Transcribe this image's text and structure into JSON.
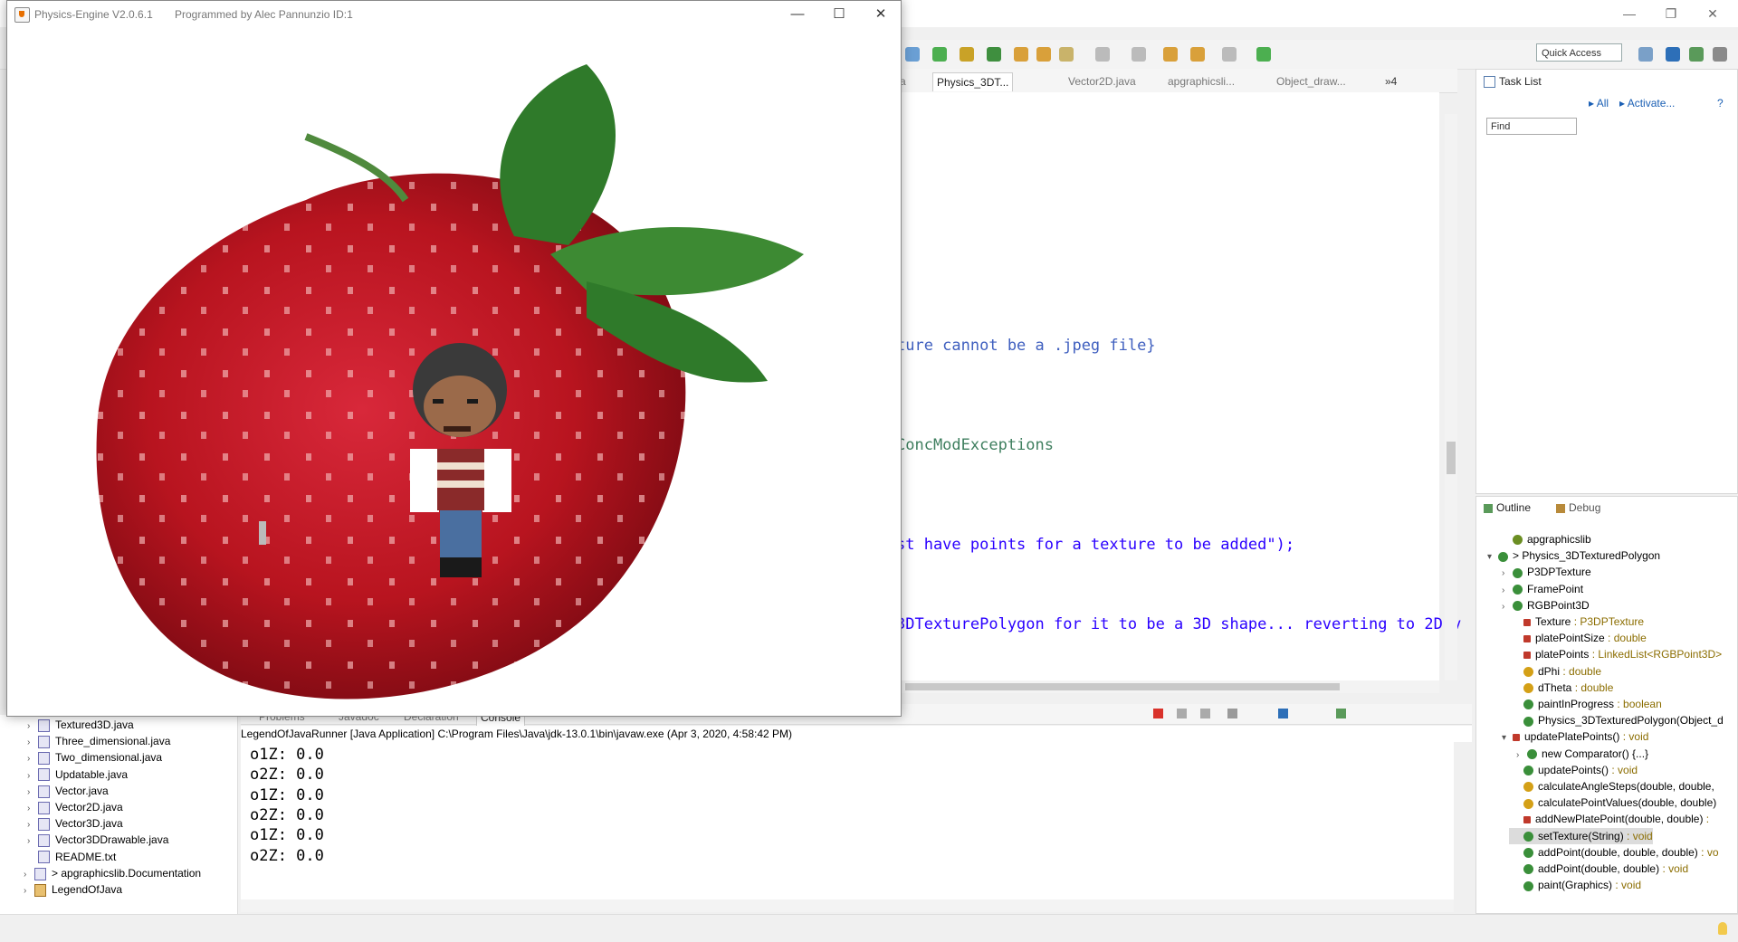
{
  "app_window": {
    "title": "Physics-Engine V2.0.6.1",
    "subtitle": "Programmed by Alec Pannunzio ID:1",
    "controls": {
      "minimize": "—",
      "maximize": "☐",
      "close": "✕"
    }
  },
  "ide": {
    "window_controls": {
      "minimize": "—",
      "restore": "❐",
      "close": "✕"
    },
    "quick_access_label": "Quick Access",
    "editor_tabs": [
      "a",
      "Physics_3DT...",
      "Vector2D.java",
      "apgraphicsli...",
      "Object_draw...",
      "»4"
    ],
    "code_fragments": [
      "ture cannot be a .jpeg file}",
      "ConcModExceptions",
      "st have points for a texture to be added\");",
      "3DTexturePolygon for it to be a 3D shape... reverting to 2D v"
    ],
    "task_list": {
      "tab": "Task List",
      "find_placeholder": "Find",
      "all_label": "All",
      "activate_label": "Activate..."
    },
    "outline": {
      "tab": "Outline",
      "debug_tab": "Debug",
      "rows": [
        {
          "label": "apgraphicslib",
          "type": "",
          "color": "#6b8e23"
        },
        {
          "label": "> Physics_3DTexturedPolygon",
          "type": "",
          "color": "#3a8f3a"
        },
        {
          "label": "P3DPTexture",
          "type": "",
          "color": "#3a8f3a"
        },
        {
          "label": "FramePoint",
          "type": "",
          "color": "#3a8f3a"
        },
        {
          "label": "RGBPoint3D",
          "type": "",
          "color": "#3a8f3a"
        },
        {
          "label": "Texture",
          "type": " : P3DPTexture",
          "color": "#c0392b"
        },
        {
          "label": "platePointSize",
          "type": " : double",
          "color": "#c0392b"
        },
        {
          "label": "platePoints",
          "type": " : LinkedList<RGBPoint3D>",
          "color": "#c0392b"
        },
        {
          "label": "dPhi",
          "type": " : double",
          "color": "#d4a017"
        },
        {
          "label": "dTheta",
          "type": " : double",
          "color": "#d4a017"
        },
        {
          "label": "paintInProgress",
          "type": " : boolean",
          "color": "#3a8f3a"
        },
        {
          "label": "Physics_3DTexturedPolygon(Object_d",
          "type": "",
          "color": "#3a8f3a"
        },
        {
          "label": "updatePlatePoints()",
          "type": " : void",
          "color": "#c0392b"
        },
        {
          "label": "new Comparator() {...}",
          "type": "",
          "color": "#3a8f3a"
        },
        {
          "label": "updatePoints()",
          "type": " : void",
          "color": "#3a8f3a"
        },
        {
          "label": "calculateAngleSteps(double, double,",
          "type": "",
          "color": "#d4a017"
        },
        {
          "label": "calculatePointValues(double, double)",
          "type": "",
          "color": "#d4a017"
        },
        {
          "label": "addNewPlatePoint(double, double)",
          "type": " : ",
          "color": "#c0392b"
        },
        {
          "label": "setTexture(String)",
          "type": " : void",
          "color": "#3a8f3a"
        },
        {
          "label": "addPoint(double, double, double)",
          "type": " : vo",
          "color": "#3a8f3a"
        },
        {
          "label": "addPoint(double, double)",
          "type": " : void",
          "color": "#3a8f3a"
        },
        {
          "label": "paint(Graphics)",
          "type": " : void",
          "color": "#3a8f3a"
        }
      ]
    },
    "package_explorer": [
      "Textured3D.java",
      "Three_dimensional.java",
      "Two_dimensional.java",
      "Updatable.java",
      "Vector.java",
      "Vector2D.java",
      "Vector3D.java",
      "Vector3DDrawable.java",
      "README.txt",
      "> apgraphicslib.Documentation",
      "LegendOfJava"
    ],
    "console": {
      "tabs": [
        "Problems",
        "Javadoc",
        "Declaration",
        "Console"
      ],
      "header": "LegendOfJavaRunner [Java Application] C:\\Program Files\\Java\\jdk-13.0.1\\bin\\javaw.exe (Apr 3, 2020, 4:58:42 PM)",
      "lines": [
        "o1Z: 0.0",
        "o2Z: 0.0",
        "o1Z: 0.0",
        "o2Z: 0.0",
        "o1Z: 0.0",
        "o2Z: 0.0"
      ]
    }
  }
}
